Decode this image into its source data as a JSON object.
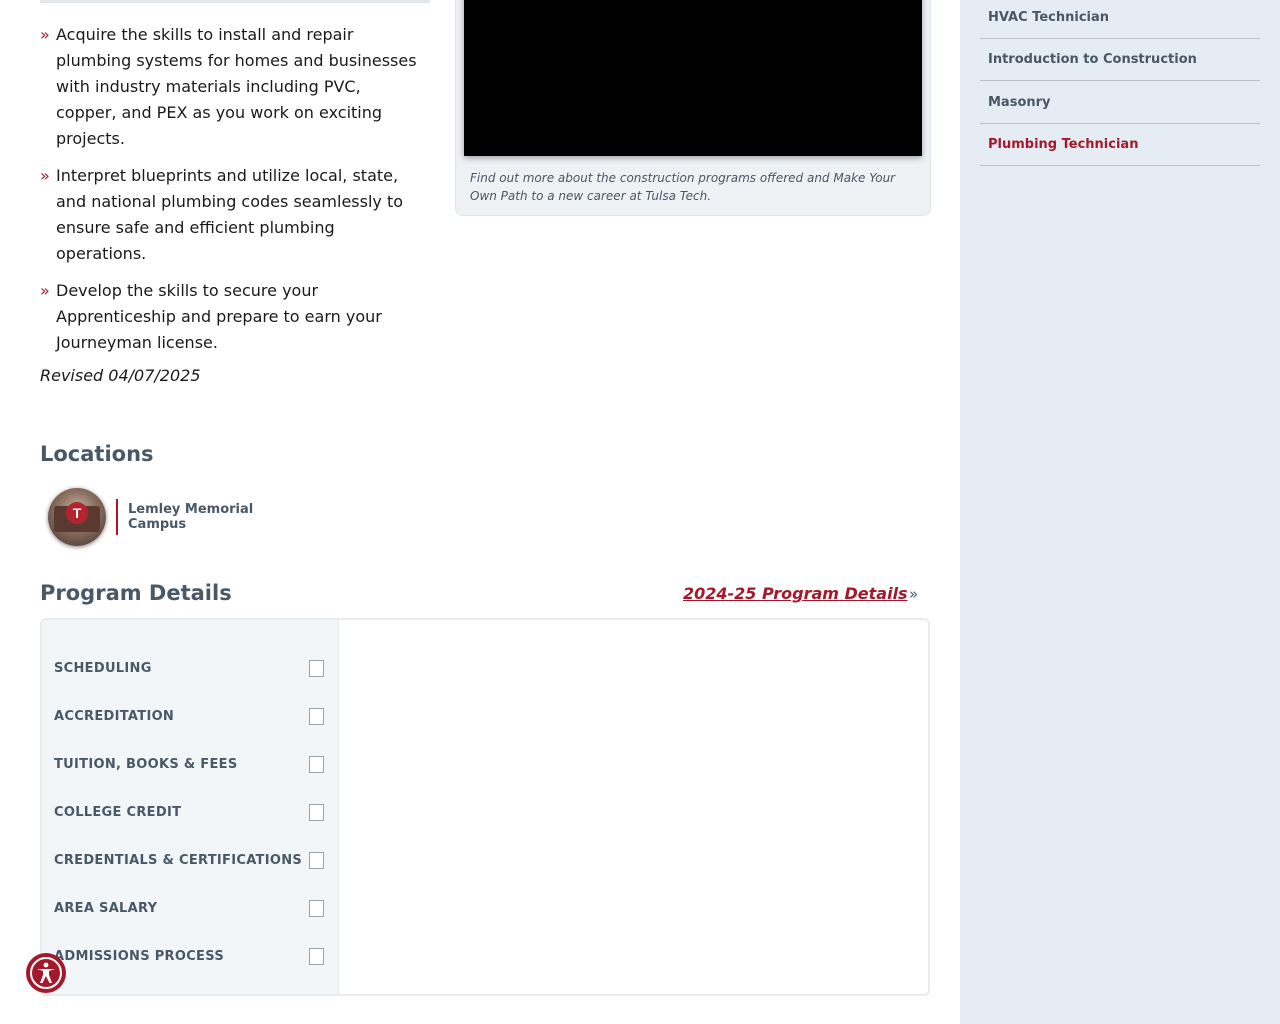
{
  "bullets": [
    "Acquire the skills to install and repair plumbing systems for homes and businesses with industry materials including PVC, copper, and PEX as you work on exciting projects.",
    "Interpret blueprints and utilize local, state, and national plumbing codes seamlessly to ensure safe and efficient plumbing operations.",
    "Develop the skills to secure your Apprenticeship and prepare to earn your Journeyman license."
  ],
  "bullet_marker": "»",
  "revised": "Revised 04/07/2025",
  "video": {
    "caption": "Find out more about the construction programs offered and Make Your Own Path to a new career at Tulsa Tech."
  },
  "locations": {
    "heading": "Locations",
    "campus": "Lemley Memorial Campus"
  },
  "program_details": {
    "heading": "Program Details",
    "link_label": "2024-25 Program Details",
    "link_marker": "»",
    "tabs": [
      "SCHEDULING",
      "ACCREDITATION",
      "TUITION, BOOKS & FEES",
      "COLLEGE CREDIT",
      "CREDENTIALS & CERTIFICATIONS",
      "AREA SALARY",
      "ADMISSIONS PROCESS"
    ]
  },
  "sidebar": {
    "items": [
      {
        "label": "HVAC Technician",
        "active": false
      },
      {
        "label": "Introduction to Construction",
        "active": false
      },
      {
        "label": "Masonry",
        "active": false
      },
      {
        "label": "Plumbing Technician",
        "active": true
      }
    ]
  },
  "colors": {
    "accent": "#a3192b",
    "heading": "#495867",
    "sidebar_bg": "#e6ecf3"
  },
  "icons": {
    "accessibility": "accessibility-icon",
    "campus_logo": "T"
  }
}
